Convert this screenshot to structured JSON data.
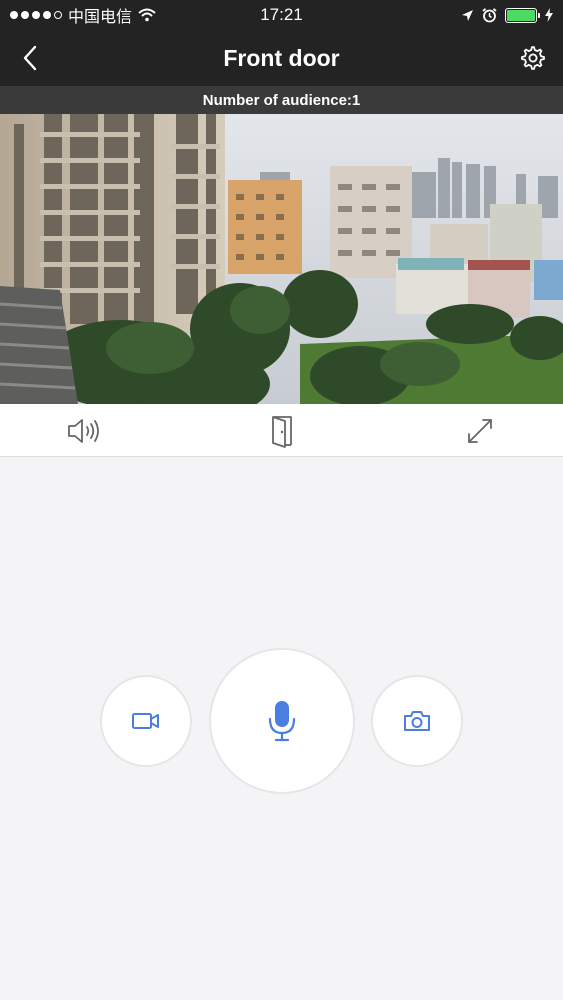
{
  "status_bar": {
    "carrier": "中国电信",
    "time": "17:21",
    "battery_level": 1.0
  },
  "header": {
    "title": "Front door",
    "back_icon": "chevron-left-icon",
    "settings_icon": "gear-icon"
  },
  "audience": {
    "text": "Number of audience:1"
  },
  "video_feed": {
    "description_icon": "camera-live-feed"
  },
  "controls": {
    "speaker_icon": "speaker-icon",
    "door_icon": "door-icon",
    "fullscreen_icon": "expand-icon"
  },
  "actions": {
    "record_icon": "video-camera-icon",
    "mic_icon": "microphone-icon",
    "snapshot_icon": "camera-icon"
  },
  "colors": {
    "accent": "#4a7ee0",
    "bar_dark": "#232323",
    "audience_bar": "#3a3a3a",
    "battery_green": "#4cd964"
  }
}
